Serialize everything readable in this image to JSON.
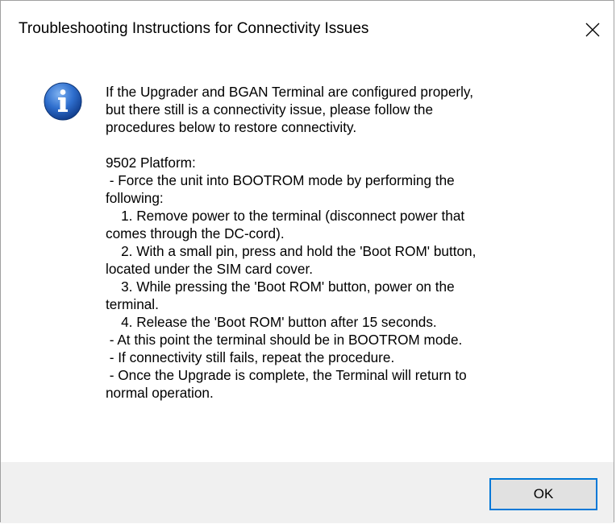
{
  "window": {
    "title": "Troubleshooting Instructions for Connectivity Issues",
    "close_icon": "close-icon"
  },
  "body": {
    "icon": "info-icon",
    "message_lines": [
      "If the Upgrader and BGAN Terminal are configured properly,",
      "but there still is a connectivity issue, please follow the",
      "procedures below to restore connectivity.",
      "",
      "9502 Platform:",
      " - Force the unit into BOOTROM mode by performing the",
      "following:",
      "    1. Remove power to the terminal (disconnect power that",
      "comes through the DC-cord).",
      "    2. With a small pin, press and hold the 'Boot ROM' button,",
      "located under the SIM card cover.",
      "    3. While pressing the 'Boot ROM' button, power on the",
      "terminal.",
      "    4. Release the 'Boot ROM' button after 15 seconds.",
      " - At this point the terminal should be in BOOTROM mode.",
      " - If connectivity still fails, repeat the procedure.",
      " - Once the Upgrade is complete, the Terminal will return to",
      "normal operation."
    ]
  },
  "buttons": {
    "ok_label": "OK"
  },
  "colors": {
    "accent": "#0078d7",
    "button_bar": "#f0f0f0",
    "icon_blue": "#1e5bb8"
  }
}
